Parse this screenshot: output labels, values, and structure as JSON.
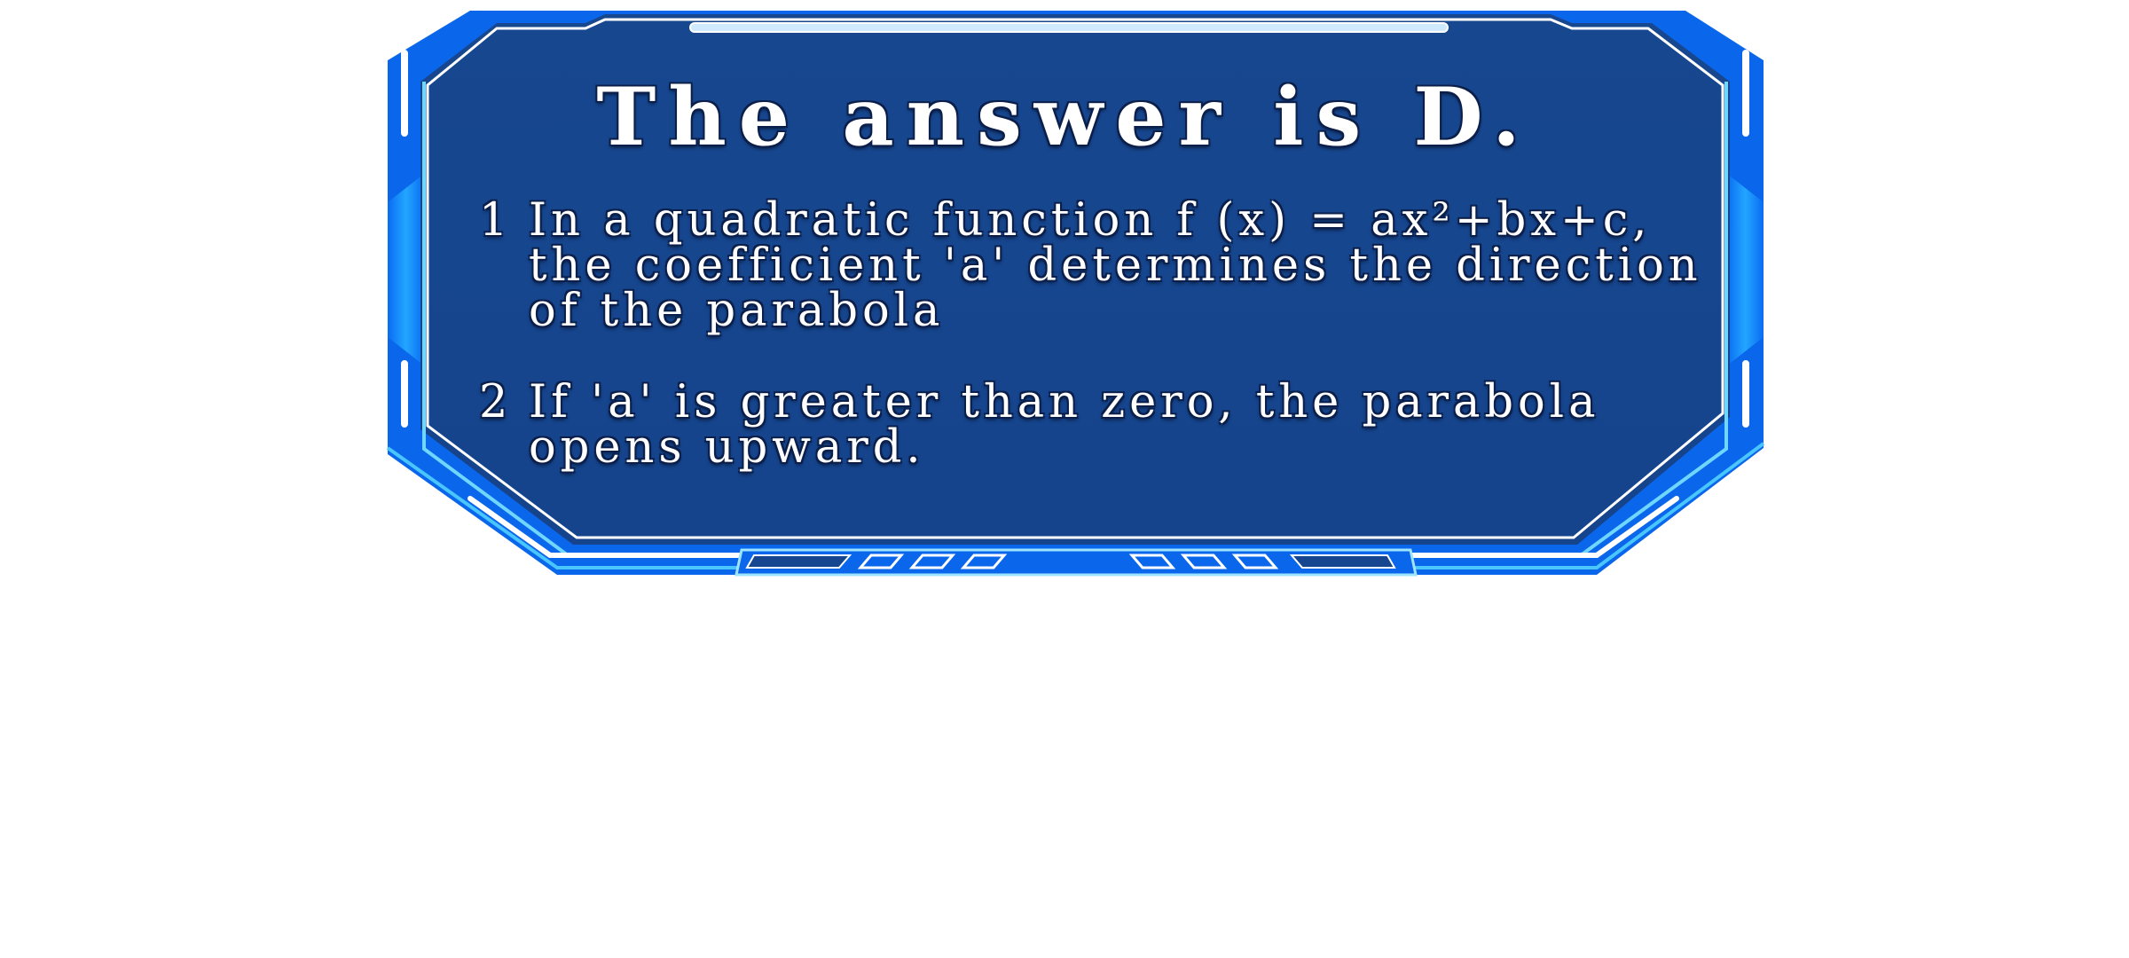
{
  "panel": {
    "title": "The answer is D.",
    "items": [
      {
        "number": "1",
        "lines": [
          "In a quadratic function f (x) = ax²+bx+c,",
          "the coefficient 'a' determines the direction",
          "of the parabola"
        ]
      },
      {
        "number": "2",
        "lines": [
          "If 'a' is greater than zero, the parabola",
          "opens upward."
        ]
      }
    ]
  },
  "colors": {
    "page_background": "#ffffff",
    "panel_fill": "#16468f",
    "frame_blue": "#0a6cf2",
    "frame_light": "#5fd2ff",
    "frame_line": "#ffffff",
    "text": "#ffffff",
    "text_outline": "#0b1f4a"
  }
}
